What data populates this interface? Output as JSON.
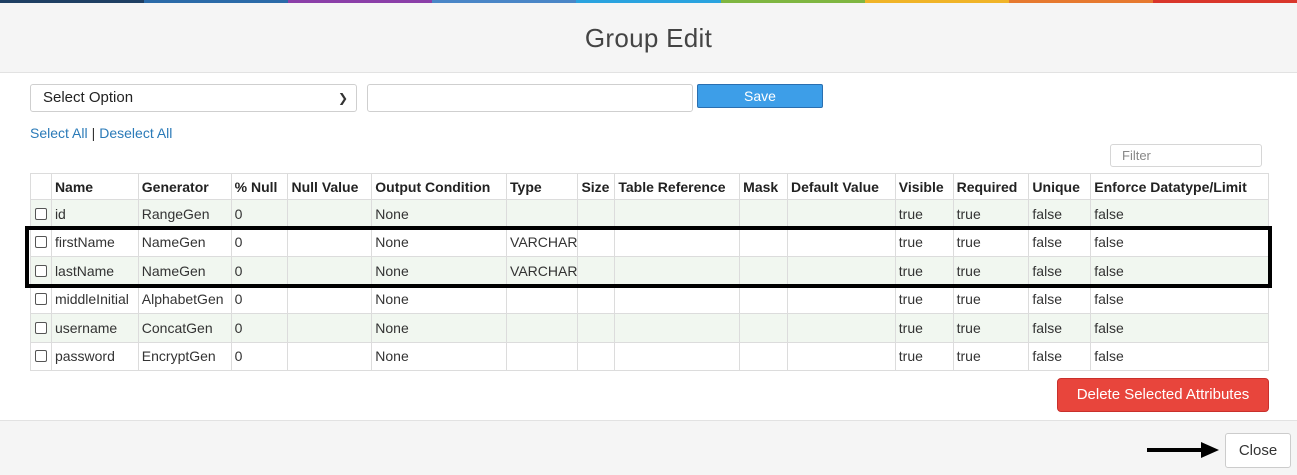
{
  "colors": {
    "rainbow": [
      "#1f3f63",
      "#2b6aa8",
      "#8b3fa8",
      "#4a86c7",
      "#2aa3df",
      "#7fb641",
      "#f0b428",
      "#e6792f",
      "#d9362b"
    ],
    "save": "#3d9ee8",
    "delete": "#e8453c",
    "link": "#2a7ab8",
    "row_stripe": "#f1f7f0"
  },
  "dialog": {
    "title": "Group Edit"
  },
  "toolbar": {
    "select_value": "Select Option",
    "text_value": "",
    "save_label": "Save"
  },
  "selection": {
    "select_all": "Select All",
    "separator": "|",
    "deselect_all": "Deselect All"
  },
  "filter": {
    "placeholder": "Filter"
  },
  "table": {
    "columns": [
      "",
      "Name",
      "Generator",
      "% Null",
      "Null Value",
      "Output Condition",
      "Type",
      "Size",
      "Table Reference",
      "Mask",
      "Default Value",
      "Visible",
      "Required",
      "Unique",
      "Enforce Datatype/Limit"
    ],
    "rows": [
      {
        "name": "id",
        "generator": "RangeGen",
        "null_pct": "0",
        "null_value": "",
        "output_condition": "None",
        "type": "",
        "size": "",
        "table_reference": "",
        "mask": "",
        "default_value": "",
        "visible": "true",
        "required": "true",
        "unique": "false",
        "enforce": "false"
      },
      {
        "name": "firstName",
        "generator": "NameGen",
        "null_pct": "0",
        "null_value": "",
        "output_condition": "None",
        "type": "VARCHAR",
        "size": "",
        "table_reference": "",
        "mask": "",
        "default_value": "",
        "visible": "true",
        "required": "true",
        "unique": "false",
        "enforce": "false"
      },
      {
        "name": "lastName",
        "generator": "NameGen",
        "null_pct": "0",
        "null_value": "",
        "output_condition": "None",
        "type": "VARCHAR",
        "size": "",
        "table_reference": "",
        "mask": "",
        "default_value": "",
        "visible": "true",
        "required": "true",
        "unique": "false",
        "enforce": "false"
      },
      {
        "name": "middleInitial",
        "generator": "AlphabetGen",
        "null_pct": "0",
        "null_value": "",
        "output_condition": "None",
        "type": "",
        "size": "",
        "table_reference": "",
        "mask": "",
        "default_value": "",
        "visible": "true",
        "required": "true",
        "unique": "false",
        "enforce": "false"
      },
      {
        "name": "username",
        "generator": "ConcatGen",
        "null_pct": "0",
        "null_value": "",
        "output_condition": "None",
        "type": "",
        "size": "",
        "table_reference": "",
        "mask": "",
        "default_value": "",
        "visible": "true",
        "required": "true",
        "unique": "false",
        "enforce": "false"
      },
      {
        "name": "password",
        "generator": "EncryptGen",
        "null_pct": "0",
        "null_value": "",
        "output_condition": "None",
        "type": "",
        "size": "",
        "table_reference": "",
        "mask": "",
        "default_value": "",
        "visible": "true",
        "required": "true",
        "unique": "false",
        "enforce": "false"
      }
    ]
  },
  "actions": {
    "delete_label": "Delete Selected Attributes",
    "close_label": "Close"
  }
}
